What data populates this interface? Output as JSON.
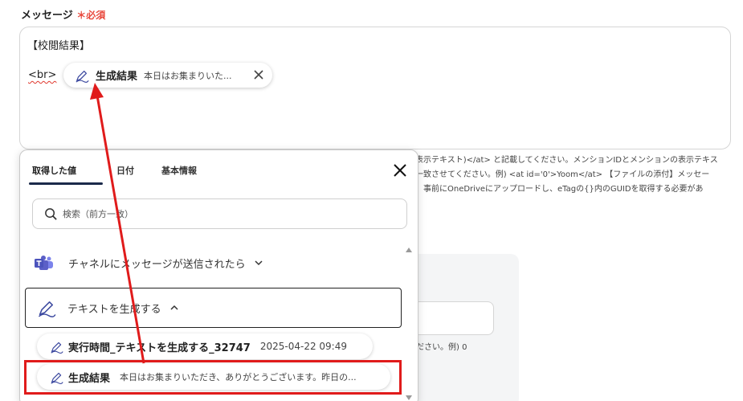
{
  "field": {
    "label": "メッセージ",
    "required": "＊必須"
  },
  "message": {
    "line1": "【校閲結果】",
    "br_tag": "<br>",
    "chip": {
      "name": "生成結果",
      "preview": "本日はお集まりいた..."
    }
  },
  "hints": [
    "表示テキスト)</at> と記載してください。メンションIDとメンションの表示テキス",
    "一致させてください。例) <at id='0'>Yoom</at> 【ファイルの添付】メッセー",
    "。事前にOneDriveにアップロードし、eTagの{}内のGUIDを取得する必要があ"
  ],
  "background_text": "ださい。例) 0",
  "panel": {
    "tabs": [
      {
        "label": "取得した値",
        "active": true
      },
      {
        "label": "日付",
        "active": false
      },
      {
        "label": "基本情報",
        "active": false
      }
    ],
    "search_placeholder": "検索（前方一致）",
    "groups": [
      {
        "label": "チャネルにメッセージが送信されたら",
        "icon": "teams-icon",
        "expanded": false
      },
      {
        "label": "テキストを生成する",
        "icon": "pen-icon",
        "expanded": true
      }
    ],
    "items": [
      {
        "name": "実行時間_テキストを生成する_32747",
        "value": "2025-04-22 09:49"
      },
      {
        "name": "生成結果",
        "value": "本日はお集まりいただき、ありがとうございます。昨日の..."
      }
    ]
  },
  "colors": {
    "required": "#e8473b",
    "highlight": "#e01b1b",
    "tab_underline": "#1b2a4a",
    "teams": "#5b5fc7",
    "pen": "#3d4aa0"
  }
}
